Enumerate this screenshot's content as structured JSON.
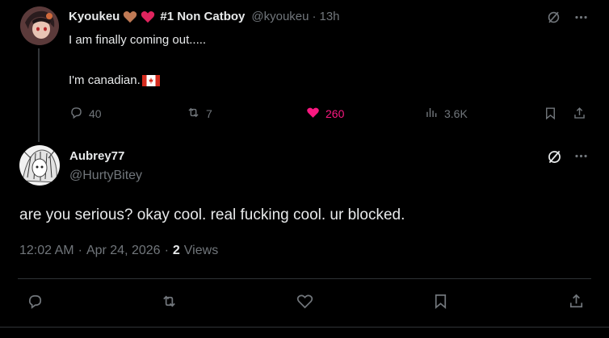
{
  "original_tweet": {
    "display_name_prefix": "Kyoukeu",
    "display_name_suffix": "#1 Non Catboy",
    "handle": "@kyoukeu",
    "separator": "·",
    "time": "13h",
    "line1": "I am finally coming out.....",
    "line2": "I'm canadian.",
    "stats": {
      "replies": "40",
      "reposts": "7",
      "likes": "260",
      "views": "3.6K"
    },
    "like_color": "#f91880"
  },
  "reply_tweet": {
    "display_name": "Aubrey77",
    "handle": "@HurtyBitey",
    "text": "are you serious? okay cool. real fucking cool. ur blocked.",
    "time": "12:02 AM",
    "sep1": "·",
    "date": "Apr 24, 2026",
    "sep2": "·",
    "views_count": "2",
    "views_label": "Views"
  },
  "colors": {
    "background": "#000000",
    "text": "#e7e9ea",
    "muted": "#71767b",
    "divider": "#2f3336"
  },
  "icons": [
    "grok-icon",
    "more-icon",
    "reply-icon",
    "repost-icon",
    "like-icon",
    "views-icon",
    "bookmark-icon",
    "share-icon",
    "heart-emoji",
    "canada-flag"
  ]
}
